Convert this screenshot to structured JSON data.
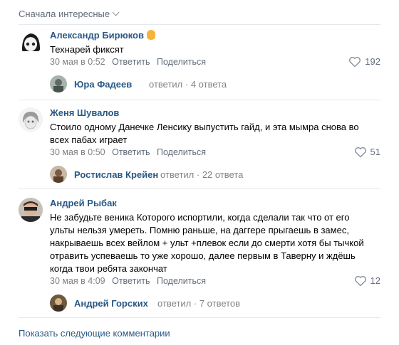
{
  "sort_label": "Сначала интересные",
  "comments": [
    {
      "author": "Александр Бирюков",
      "text": "Технарей фиксят",
      "date": "30 мая в 0:52",
      "reply_label": "Ответить",
      "share_label": "Поделиться",
      "likes": "192",
      "thread": {
        "author": "Юра Фадеев",
        "verb": "ответил",
        "count": "4 ответа"
      }
    },
    {
      "author": "Женя Шувалов",
      "text": "Стоило одному Данечке Ленсику выпустить гайд, и эта мымра снова во всех пабах играет",
      "date": "30 мая в 0:50",
      "reply_label": "Ответить",
      "share_label": "Поделиться",
      "likes": "51",
      "thread": {
        "author": "Ростислав Крейен",
        "verb": "ответил",
        "count": "22 ответа"
      }
    },
    {
      "author": "Андрей Рыбак",
      "text": "Не забудьте веника Которого испортили, когда сделали так что от его ульты нельзя умереть. Помню раньше, на даггере прыгаешь в замес, накрываешь всех вейлом + ульт +плевок если до смерти хотя бы тычкой отравить успеваешь то уже хорошо, далее первым в Таверну и ждёшь когда твои ребята закончат",
      "date": "30 мая в 4:09",
      "reply_label": "Ответить",
      "share_label": "Поделиться",
      "likes": "12",
      "thread": {
        "author": "Андрей Горских",
        "verb": "ответил",
        "count": "7 ответов"
      }
    }
  ],
  "show_more_label": "Показать следующие комментарии",
  "colors": {
    "link": "#2a5885",
    "meta": "#828282",
    "divider": "#e7e8ec"
  },
  "icons": {
    "like": "heart-outline-icon",
    "sort": "chevron-down-icon"
  }
}
